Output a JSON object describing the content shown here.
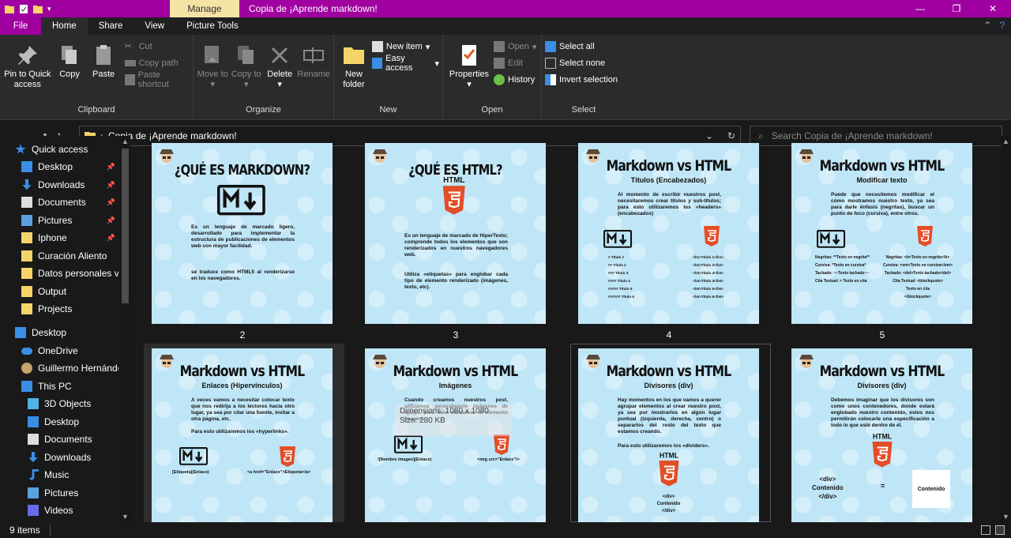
{
  "titlebar": {
    "manage": "Manage",
    "title": "Copia de ¡Aprende markdown!",
    "min": "—",
    "max": "❐",
    "close": "✕"
  },
  "tabs": [
    "File",
    "Home",
    "Share",
    "View",
    "Picture Tools"
  ],
  "ribbon": {
    "clipboard": {
      "pin": "Pin to Quick access",
      "copy": "Copy",
      "paste": "Paste",
      "cut": "Cut",
      "copy_path": "Copy path",
      "paste_shortcut": "Paste shortcut",
      "label": "Clipboard"
    },
    "organize": {
      "move": "Move to",
      "copy": "Copy to",
      "delete": "Delete",
      "rename": "Rename",
      "label": "Organize"
    },
    "new": {
      "folder": "New folder",
      "item": "New item",
      "easy": "Easy access",
      "label": "New"
    },
    "open": {
      "properties": "Properties",
      "open": "Open",
      "edit": "Edit",
      "history": "History",
      "label": "Open"
    },
    "select": {
      "all": "Select all",
      "none": "Select none",
      "invert": "Invert selection",
      "label": "Select"
    }
  },
  "address": {
    "path": "Copia de ¡Aprende markdown!",
    "search_placeholder": "Search Copia de ¡Aprende markdown!"
  },
  "sidebar": [
    {
      "label": "Quick access",
      "icon": "star-icon"
    },
    {
      "label": "Desktop",
      "icon": "desktop-icon",
      "pin": true
    },
    {
      "label": "Downloads",
      "icon": "download-icon",
      "pin": true
    },
    {
      "label": "Documents",
      "icon": "documents-icon",
      "pin": true
    },
    {
      "label": "Pictures",
      "icon": "pictures-icon",
      "pin": true
    },
    {
      "label": "Iphone",
      "icon": "folder-icon",
      "pin": true
    },
    {
      "label": "Curación Aliento",
      "icon": "folder-icon"
    },
    {
      "label": "Datos personales vit",
      "icon": "folder-icon"
    },
    {
      "label": "Output",
      "icon": "folder-icon"
    },
    {
      "label": "Projects",
      "icon": "folder-icon"
    },
    {
      "label": "Desktop",
      "icon": "desktop-icon"
    },
    {
      "label": "OneDrive",
      "icon": "cloud-icon"
    },
    {
      "label": "Guillermo Hernánde",
      "icon": "user-icon"
    },
    {
      "label": "This PC",
      "icon": "pc-icon"
    },
    {
      "label": "3D Objects",
      "icon": "cube-icon"
    },
    {
      "label": "Desktop",
      "icon": "desktop-icon"
    },
    {
      "label": "Documents",
      "icon": "documents-icon"
    },
    {
      "label": "Downloads",
      "icon": "download-icon"
    },
    {
      "label": "Music",
      "icon": "music-icon"
    },
    {
      "label": "Pictures",
      "icon": "pictures-icon"
    },
    {
      "label": "Videos",
      "icon": "videos-icon"
    }
  ],
  "thumbs": [
    {
      "label": "2",
      "title": "¿QUÉ ES MARKDOWN?",
      "subtitle": "",
      "body": "Es un lenguaje de marcado ligero, desarrollado para implementar la estructura de publicaciones de elementos web con mayor facilidad.",
      "body2": "se traduce como HTML5 al renderizarse en los navegadores."
    },
    {
      "label": "3",
      "title": "¿QUÉ ES HTML?",
      "subtitle": "",
      "body": "Es un lenguaje de marcado de HiperTexto; comprende todos los elementos que son renderizados en nuestros navegadores web.",
      "body2": "Utiliza «etiquetas» para englobar cada tipo de elemento renderizado (imágenes, texto, etc)."
    },
    {
      "label": "4",
      "title": "Markdown vs HTML",
      "subtitle": "Títulos (Encabezados)",
      "body": "Al momento de escribir nuestros post, necesitaremos crear títulos y sub-títulos; para esto utilizaremos los «headers» (encabezados)",
      "left": "# Título 1\n## Título 2\n### Título 3\n#### Título 4\n##### Título 5\n###### Título 6",
      "right": "<h1>Título 1</h1>\n<h2>Título 2</h2>\n<h3>Título 3</h3>\n<h4>Título 4</h4>\n<h5>Título 5</h5>\n<h6>Título 6</h6>"
    },
    {
      "label": "5",
      "title": "Markdown vs HTML",
      "subtitle": "Modificar texto",
      "body": "Puede que necesitemos modificar el cómo mostramos nuestro texto, ya sea para darle énfasis (negritas), buscar un punto de foco (cursiva), entre otros.",
      "left": "Negritas: **Texto en negrita**\nCursiva: *Texto en cursiva*\nTachado: ~~Texto tachado~~\nCita Textual: > Texto en cita",
      "right": "Negritas: <b>Texto en negrita</b>\nCursiva: <em>Texto en cursiva</em>\nTachado: <del>Texto tachado</del>\nCita Textual: <blockquote>\nTexto en cita\n</blockquote>"
    },
    {
      "label": "",
      "title": "Markdown vs HTML",
      "subtitle": "Enlaces (Hipervínculos)",
      "body": "A veces vamos a necesitar colocar texto que nos redirija a los lectores hacia otro lugar, ya sea por citar una fuente, invitar a otra página, etc.",
      "body2": "Para esto utilizaremos los «hyperlinks».",
      "left": "[Etiqueta](Enlace)",
      "right": "<a href=\"Enlace\">Etiqueta</a>"
    },
    {
      "label": "",
      "title": "Markdown vs HTML",
      "subtitle": "Imágenes",
      "body": "Cuando creamos nuestros post, utilizamos generalmente imágenes de apoyo, para esto utilizamos el elemento imagen.",
      "left": "![Nombre imagen](Enlace)",
      "right": "<img src=\"Enlace\"/>"
    },
    {
      "label": "",
      "title": "Markdown vs HTML",
      "subtitle": "Divisores (div)",
      "body": "Hay momentos en los que vamos a querer agrupar elementos al crear nuestro post, ya sea por mostrarlos en algún lugar puntual (izquierda, derecha, centro) o separarlos del resto del texto que estamos creando.",
      "body2": "Para esto utilizaremos los «dividers».",
      "left": "<div>\nContenido\n</div>"
    },
    {
      "label": "",
      "title": "Markdown vs HTML",
      "subtitle": "Divisores (div)",
      "body": "Debemos imaginar que los divisores son como unos contenedores, donde estará englobado nuestro contenido, estos nos permitirán colocarle una especificación a todo lo que esté dentro de él.",
      "left": "<div>\nContenido\n</div>",
      "eq": "=",
      "right": "Contenido"
    }
  ],
  "tooltip": {
    "line1": "Dimensions: 1080 x 1080",
    "line2": "Size: 280 KB"
  },
  "status": {
    "items": "9 items"
  }
}
